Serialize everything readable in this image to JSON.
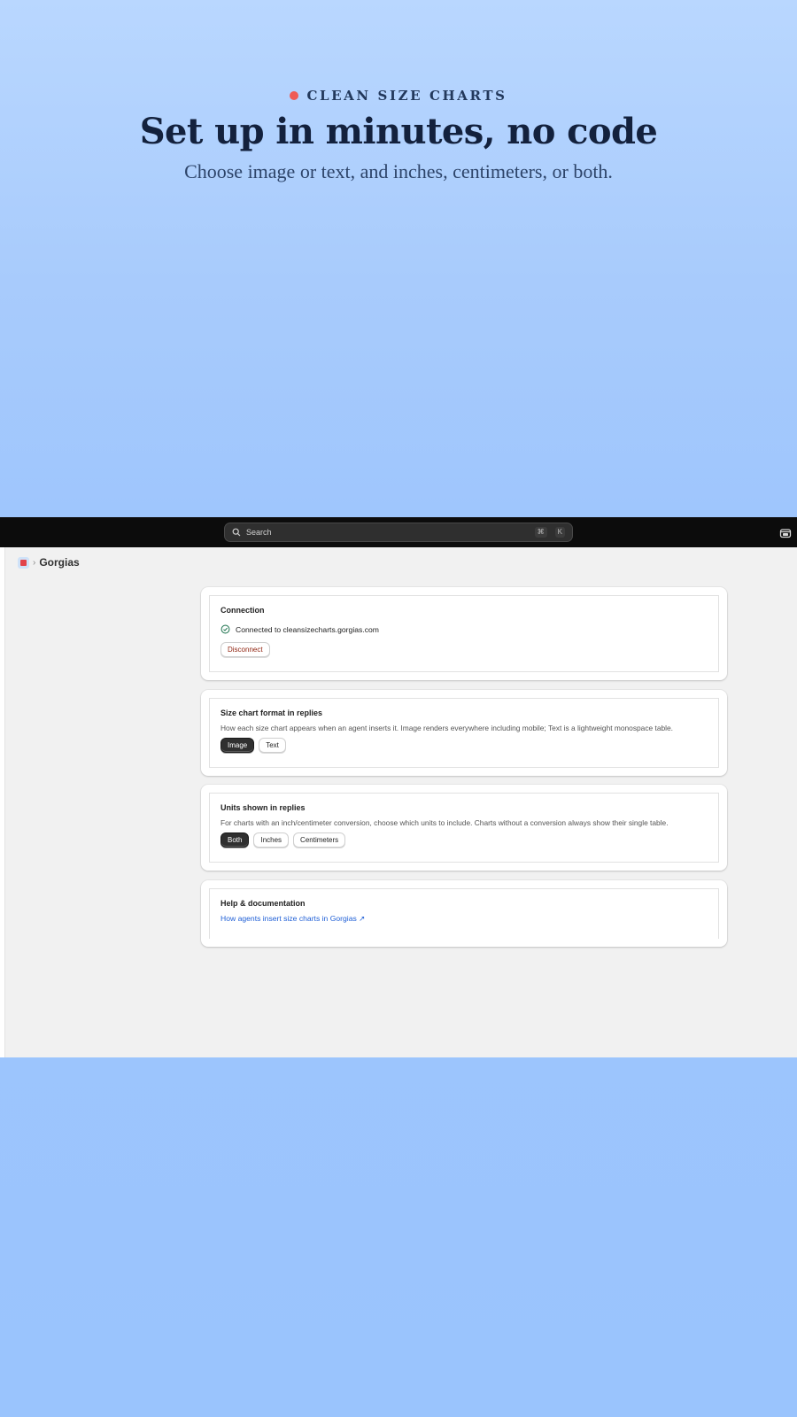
{
  "hero": {
    "eyebrow": "CLEAN SIZE CHARTS",
    "headline": "Set up in minutes, no code",
    "subhead": "Choose image or text, and inches, centimeters, or both."
  },
  "topbar": {
    "search_placeholder": "Search",
    "shortcut_cmd": "⌘",
    "shortcut_key": "K"
  },
  "breadcrumb": {
    "separator": "›",
    "title": "Gorgias"
  },
  "connection": {
    "title": "Connection",
    "status": "Connected to cleansizecharts.gorgias.com",
    "disconnect_label": "Disconnect"
  },
  "format": {
    "title": "Size chart format in replies",
    "description": "How each size chart appears when an agent inserts it. Image renders everywhere including mobile; Text is a lightweight monospace table.",
    "options": [
      "Image",
      "Text"
    ],
    "selected": "Image"
  },
  "units": {
    "title": "Units shown in replies",
    "description": "For charts with an inch/centimeter conversion, choose which units to include. Charts without a conversion always show their single table.",
    "options": [
      "Both",
      "Inches",
      "Centimeters"
    ],
    "selected": "Both"
  },
  "help": {
    "title": "Help & documentation",
    "link_label": "How agents insert size charts in Gorgias ↗"
  },
  "colors": {
    "accent_dot": "#ef5b55",
    "link": "#1f5fd6",
    "danger": "#8e1f0b",
    "success": "#2e7d5b"
  }
}
